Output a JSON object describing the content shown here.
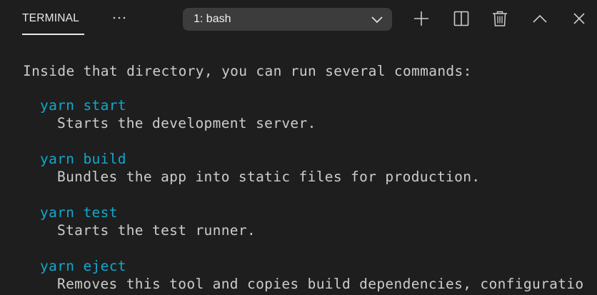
{
  "header": {
    "tab_label": "TERMINAL",
    "more_icon": "ellipsis-icon",
    "select_value": "1: bash",
    "actions": [
      "plus-icon",
      "split-icon",
      "trash-icon",
      "chevron-up-icon",
      "close-icon"
    ]
  },
  "terminal": {
    "intro": "Inside that directory, you can run several commands:",
    "commands": [
      {
        "cmd": "yarn start",
        "desc": "Starts the development server."
      },
      {
        "cmd": "yarn build",
        "desc": "Bundles the app into static files for production."
      },
      {
        "cmd": "yarn test",
        "desc": "Starts the test runner."
      },
      {
        "cmd": "yarn eject",
        "desc": "Removes this tool and copies build dependencies, configuratio"
      }
    ]
  },
  "colors": {
    "background": "#1e1e1e",
    "text": "#cccccc",
    "command": "#11a8cd",
    "select_bg": "#3c3c3c"
  }
}
